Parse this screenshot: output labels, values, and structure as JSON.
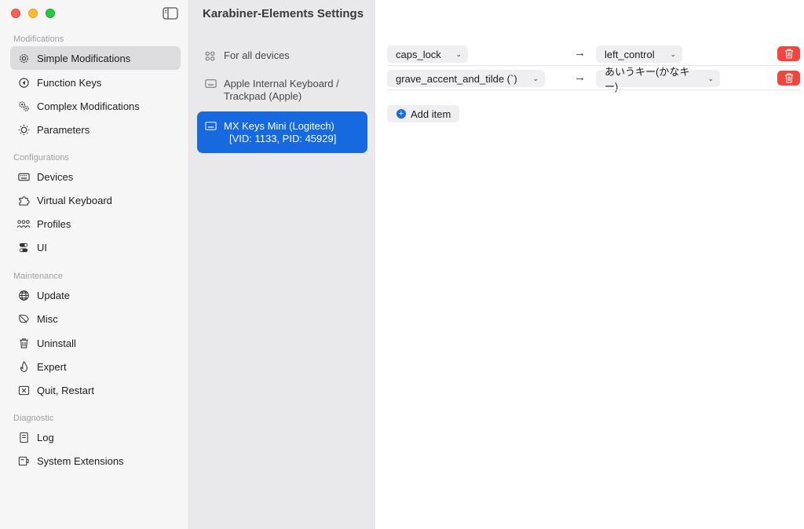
{
  "window": {
    "title": "Karabiner-Elements Settings"
  },
  "sidebar": {
    "sections": [
      {
        "header": "Modifications",
        "items": [
          {
            "label": "Simple Modifications",
            "icon": "gear-icon",
            "selected": true
          },
          {
            "label": "Function Keys",
            "icon": "function-key-icon"
          },
          {
            "label": "Complex Modifications",
            "icon": "gears-icon"
          },
          {
            "label": "Parameters",
            "icon": "sun-dial-icon"
          }
        ]
      },
      {
        "header": "Configurations",
        "items": [
          {
            "label": "Devices",
            "icon": "keyboard-icon"
          },
          {
            "label": "Virtual Keyboard",
            "icon": "puzzle-icon"
          },
          {
            "label": "Profiles",
            "icon": "people-icon"
          },
          {
            "label": "UI",
            "icon": "toggles-icon"
          }
        ]
      },
      {
        "header": "Maintenance",
        "items": [
          {
            "label": "Update",
            "icon": "globe-icon"
          },
          {
            "label": "Misc",
            "icon": "leaf-icon"
          },
          {
            "label": "Uninstall",
            "icon": "trash-icon"
          },
          {
            "label": "Expert",
            "icon": "flame-icon"
          },
          {
            "label": "Quit, Restart",
            "icon": "xmark-box-icon"
          }
        ]
      },
      {
        "header": "Diagnostic",
        "items": [
          {
            "label": "Log",
            "icon": "document-icon"
          },
          {
            "label": "System Extensions",
            "icon": "extension-icon"
          }
        ]
      }
    ]
  },
  "devices": {
    "items": [
      {
        "label": "For all devices",
        "icon": "grid-icon"
      },
      {
        "label_line1": "Apple Internal Keyboard /",
        "label_line2": "Trackpad (Apple)",
        "icon": "keyboard-icon"
      },
      {
        "label_line1": "MX Keys Mini (Logitech)",
        "label_line2": "[VID: 1133, PID: 45929]",
        "icon": "keyboard-icon",
        "selected": true
      }
    ]
  },
  "mappings": [
    {
      "from": "caps_lock",
      "to": "left_control"
    },
    {
      "from": "grave_accent_and_tilde (`)",
      "to": "あいうキー(かなキー)"
    }
  ],
  "actions": {
    "add_item": "Add item"
  },
  "colors": {
    "accent": "#1769e0",
    "delete": "#f2453d"
  }
}
